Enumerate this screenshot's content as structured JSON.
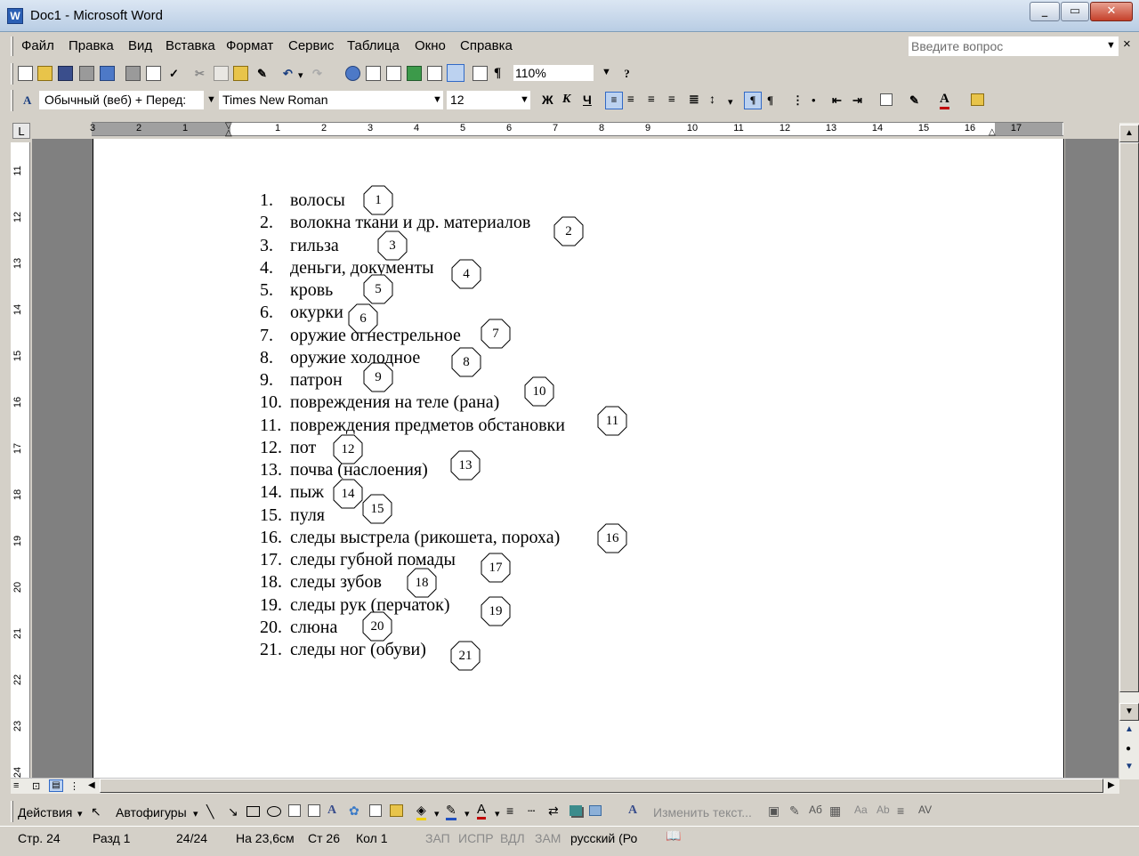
{
  "window": {
    "title": "Doc1 - Microsoft Word",
    "app_icon": "W"
  },
  "menu": {
    "items": [
      "Файл",
      "Правка",
      "Вид",
      "Вставка",
      "Формат",
      "Сервис",
      "Таблица",
      "Окно",
      "Справка"
    ],
    "help_placeholder": "Введите вопрос",
    "close_glyph": "×"
  },
  "toolbar": {
    "zoom": "110%",
    "pilcrow": "¶"
  },
  "formatting": {
    "style": "Обычный (веб) + Перед:",
    "font": "Times New Roman",
    "size": "12",
    "bold": "Ж",
    "italic": "К",
    "underline": "Ч"
  },
  "ruler": {
    "corner": "L",
    "h_numbers": [
      "3",
      "2",
      "1",
      "1",
      "1",
      "2",
      "3",
      "4",
      "5",
      "6",
      "7",
      "8",
      "9",
      "10",
      "11",
      "12",
      "13",
      "14",
      "15",
      "16",
      "17"
    ],
    "v_numbers": [
      "11",
      "12",
      "13",
      "14",
      "15",
      "16",
      "17",
      "18",
      "19",
      "20",
      "21",
      "22",
      "23",
      "24"
    ]
  },
  "document": {
    "items": [
      {
        "num": "1.",
        "text": "волосы"
      },
      {
        "num": "2.",
        "text": "волокна ткани и др. материалов"
      },
      {
        "num": "3.",
        "text": "гильза"
      },
      {
        "num": "4.",
        "text": "деньги, документы"
      },
      {
        "num": "5.",
        "text": "кровь"
      },
      {
        "num": "6.",
        "text": "окурки"
      },
      {
        "num": "7.",
        "text": "оружие огнестрельное"
      },
      {
        "num": "8.",
        "text": "оружие холодное"
      },
      {
        "num": "9.",
        "text": "патрон"
      },
      {
        "num": "10.",
        "text": "повреждения на теле (рана)"
      },
      {
        "num": "11.",
        "text": "повреждения предметов обстановки"
      },
      {
        "num": "12.",
        "text": "пот"
      },
      {
        "num": "13.",
        "text": "почва (наслоения)"
      },
      {
        "num": "14.",
        "text": "пыж"
      },
      {
        "num": "15.",
        "text": "пуля"
      },
      {
        "num": "16.",
        "text": "следы выстрела (рикошета, пороха)"
      },
      {
        "num": "17.",
        "text": "следы губной помады"
      },
      {
        "num": "18.",
        "text": "следы зубов"
      },
      {
        "num": "19.",
        "text": "следы рук (перчаток)"
      },
      {
        "num": "20.",
        "text": "слюна"
      },
      {
        "num": "21.",
        "text": "следы ног (обуви)"
      }
    ],
    "markers": [
      "1",
      "2",
      "3",
      "4",
      "5",
      "6",
      "7",
      "8",
      "9",
      "10",
      "11",
      "12",
      "13",
      "14",
      "15",
      "16",
      "17",
      "18",
      "19",
      "20",
      "21"
    ]
  },
  "drawing": {
    "actions": "Действия",
    "autoshapes": "Автофигуры",
    "change_text": "Изменить текст..."
  },
  "status": {
    "page": "Стр. 24",
    "section": "Разд 1",
    "pages": "24/24",
    "at": "На 23,6см",
    "line": "Ст 26",
    "col": "Кол 1",
    "rec": "ЗАП",
    "trk": "ИСПР",
    "ext": "ВДЛ",
    "ovr": "ЗАМ",
    "lang": "русский (Ро"
  }
}
